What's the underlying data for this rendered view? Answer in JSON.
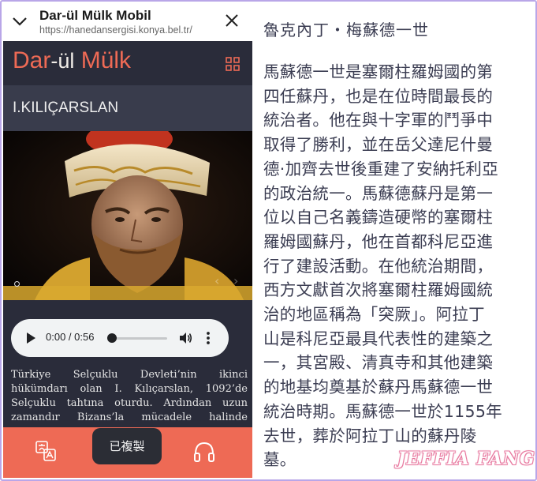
{
  "browser": {
    "title": "Dar-ül Mülk Mobil",
    "url": "https://hanedansergisi.konya.bel.tr/"
  },
  "app": {
    "logo_part1": "Dar",
    "logo_sep": "-",
    "logo_part2": "ül",
    "logo_part3": "Mülk",
    "section_title": "I.KILIÇARSLAN"
  },
  "audio": {
    "time": "0:00 / 0:56"
  },
  "article": {
    "text": "Türkiye Selçuklu Devleti’nin ikinci hükümdarı olan I. Kılıçarslan, 1092’de Selçuklu tahtına oturdu. Ardından uzun zamandır Bizans’la mücadele halinde"
  },
  "toast": {
    "text": "已複製"
  },
  "right": {
    "heading": "魯克內丁・梅蘇德一世",
    "lines": [
      "馬蘇德一世是塞爾柱羅姆國的第",
      "四任蘇丹，也是在位時間最長的",
      "統治者。他在與十字軍的鬥爭中",
      "取得了勝利，並在岳父達尼什曼",
      "德·加齊去世後重建了安納托利亞",
      "的政治統一。馬蘇德蘇丹是第一",
      "位以自己名義鑄造硬幣的塞爾柱",
      "羅姆國蘇丹，他在首都科尼亞進",
      "行了建設活動。在他統治期間，",
      "西方文獻首次將塞爾柱羅姆國統",
      "治的地區稱為「突厥」。阿拉丁",
      "山是科尼亞最具代表性的建築之",
      "一，其宮殿、清真寺和其他建築",
      "的地基均奠基於蘇丹馬蘇德一世",
      "統治時期。馬蘇德一世於1155年",
      "去世，葬於阿拉丁山的蘇丹陵",
      "墓。"
    ],
    "watermark": "JEFFIA FANG"
  },
  "colors": {
    "accent": "#ee6a55",
    "header_bg": "#2a2c3a",
    "title_bar_bg": "#393c4c",
    "text_purple": "#3b3d52"
  },
  "icons": {
    "collapse": "chevron-down-icon",
    "close": "close-icon",
    "menu": "grid-icon",
    "play": "play-icon",
    "volume": "volume-icon",
    "more": "more-vert-icon",
    "translate": "translate-icon",
    "audio_guide": "headphones-icon"
  }
}
